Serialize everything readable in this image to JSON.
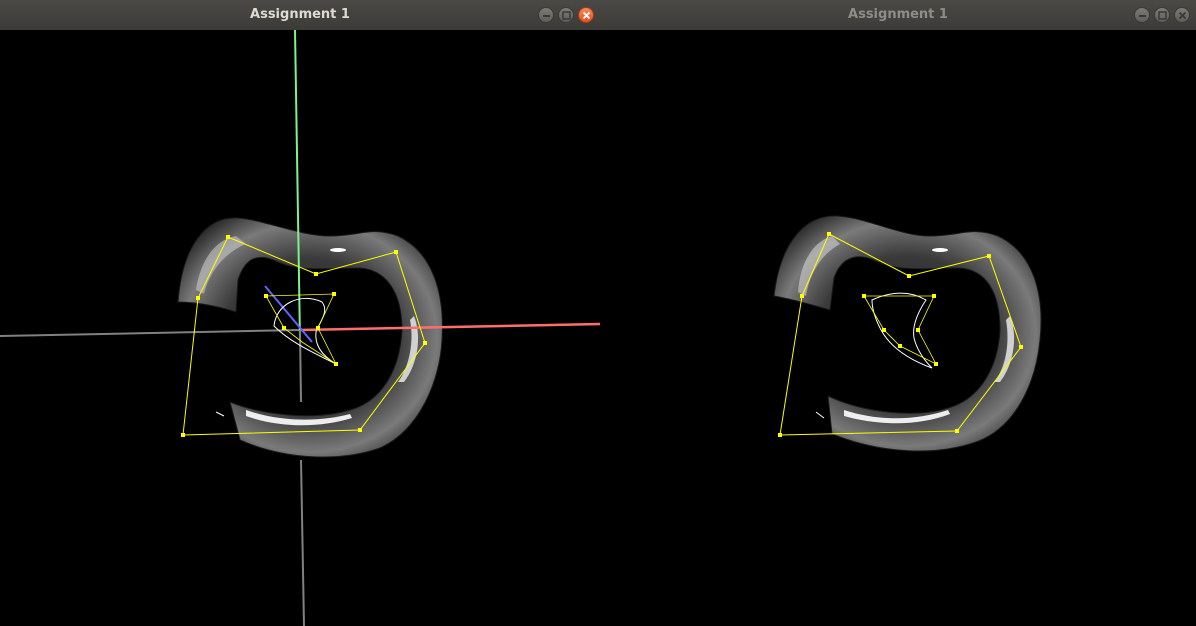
{
  "windows": {
    "left": {
      "title": "Assignment 1",
      "active": true
    },
    "right": {
      "title": "Assignment 1",
      "active": false
    }
  },
  "colors": {
    "titlebar": "#3c3b37",
    "title_active": "#dfdbd2",
    "title_inactive": "#8f8d87",
    "close_button": "#e95420",
    "control_polygon": "#ffff00",
    "profile_curve": "#ffffff",
    "axis_x": "#ff6e6e",
    "axis_y": "#7ff28a",
    "axis_z": "#6464ff",
    "axis_gray": "#808080",
    "surface": "#505050",
    "background": "#000000"
  },
  "icons": {
    "minimize": "minimize-icon",
    "maximize": "maximize-icon",
    "close": "close-icon"
  }
}
